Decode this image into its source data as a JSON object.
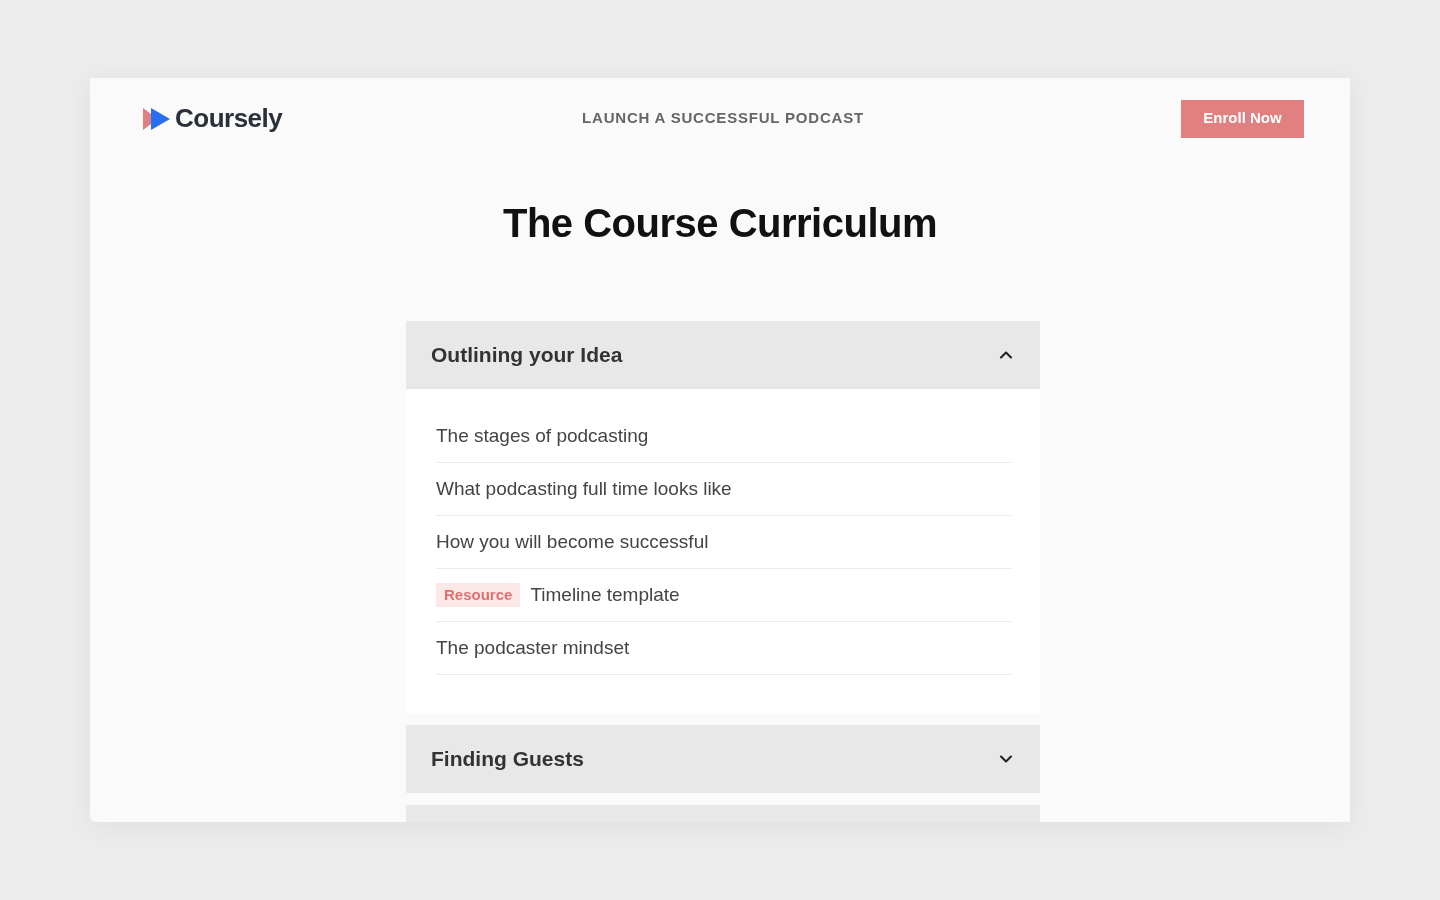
{
  "brand": {
    "name": "Coursely"
  },
  "nav": {
    "title": "LAUNCH A SUCCESSFUL PODCAST",
    "cta": "Enroll Now"
  },
  "heading": "The Course Curriculum",
  "sections": [
    {
      "title": "Outlining your Idea",
      "expanded": true,
      "lessons": [
        {
          "title": "The stages of podcasting"
        },
        {
          "title": "What podcasting full time looks like"
        },
        {
          "title": "How you will become successful"
        },
        {
          "tag": "Resource",
          "title": "Timeline template"
        },
        {
          "title": "The podcaster mindset"
        }
      ]
    },
    {
      "title": "Finding Guests",
      "expanded": false
    }
  ]
}
